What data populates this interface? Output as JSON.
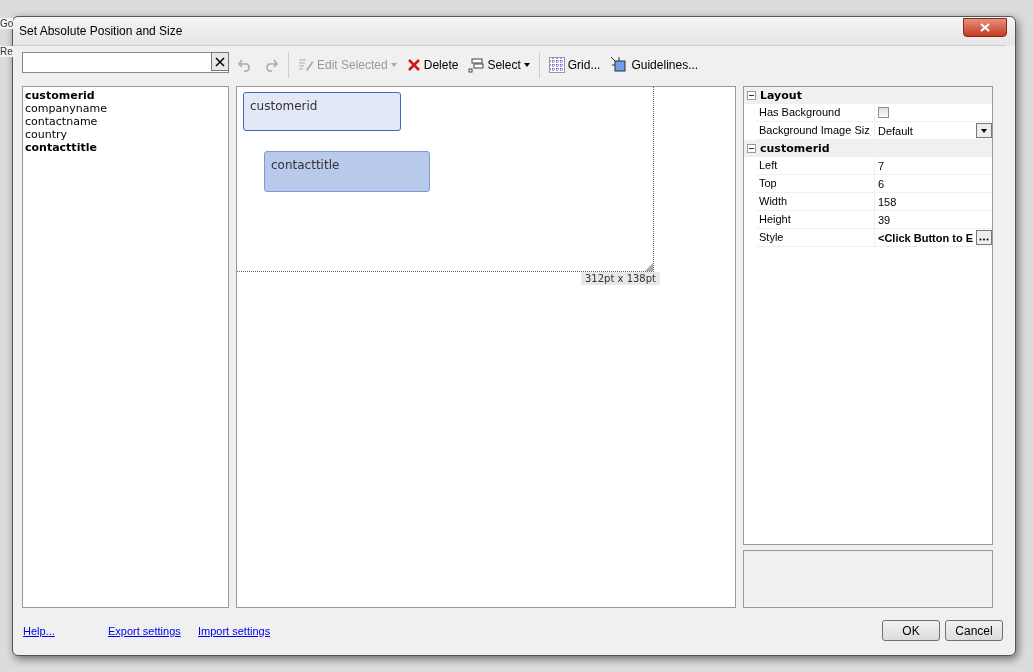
{
  "background": {
    "fragments": [
      "Go",
      "Re"
    ]
  },
  "window": {
    "title": "Set Absolute Position and Size"
  },
  "search": {
    "clear_button": true
  },
  "fields": [
    {
      "label": "customerid",
      "placed": true
    },
    {
      "label": "companyname",
      "placed": false
    },
    {
      "label": "contactname",
      "placed": false
    },
    {
      "label": "country",
      "placed": false
    },
    {
      "label": "contacttitle",
      "placed": true
    }
  ],
  "toolbar": [
    {
      "kind": "undo",
      "disabled": true
    },
    {
      "kind": "redo",
      "disabled": true
    },
    {
      "kind": "edit",
      "label": "Edit Selected",
      "disabled": true,
      "dropdown": true
    },
    {
      "kind": "delete",
      "label": "Delete",
      "disabled": false,
      "dropdown": false
    },
    {
      "kind": "select",
      "label": "Select",
      "disabled": false,
      "dropdown": true
    },
    {
      "kind": "grid",
      "label": "Grid...",
      "disabled": false,
      "dropdown": false
    },
    {
      "kind": "guidelines",
      "label": "Guidelines...",
      "disabled": false,
      "dropdown": false
    }
  ],
  "canvas": {
    "size_label": "312pt x 138pt",
    "items": [
      {
        "label": "customerid",
        "selected": true
      },
      {
        "label": "contacttitle",
        "selected": false
      }
    ]
  },
  "properties": [
    {
      "category": "Layout",
      "expanded": true,
      "rows": [
        {
          "name": "Has Background",
          "kind": "checkbox",
          "checked": false
        },
        {
          "name": "Background Image Siz",
          "kind": "dropdown",
          "value": "Default"
        }
      ]
    },
    {
      "category": "customerid",
      "expanded": true,
      "rows": [
        {
          "name": "Left",
          "kind": "text",
          "value": "7"
        },
        {
          "name": "Top",
          "kind": "text",
          "value": "6"
        },
        {
          "name": "Width",
          "kind": "text",
          "value": "158"
        },
        {
          "name": "Height",
          "kind": "text",
          "value": "39"
        },
        {
          "name": "Style",
          "kind": "button",
          "value": "<Click Button to E"
        }
      ]
    }
  ],
  "links": [
    "Help...",
    "Export settings",
    "Import settings"
  ],
  "buttons": [
    "OK",
    "Cancel"
  ]
}
